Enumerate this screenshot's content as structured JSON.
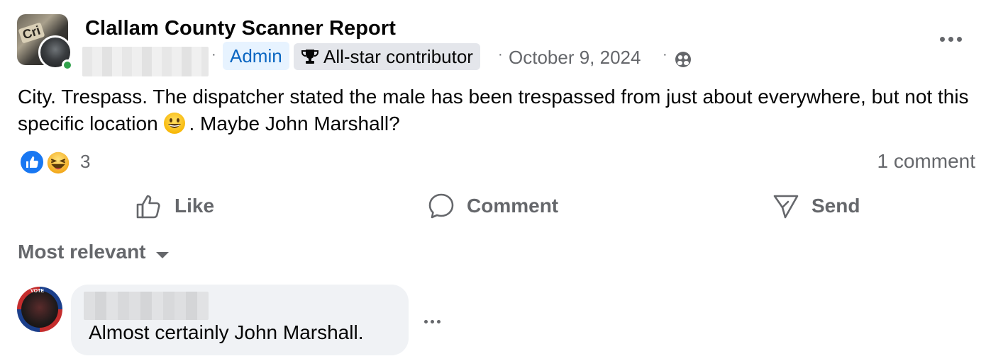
{
  "post": {
    "group_name": "Clallam County Scanner Report",
    "author_name_blurred": true,
    "separator": "·",
    "badges": {
      "admin": "Admin",
      "contributor": "All-star contributor"
    },
    "date": "October 9, 2024",
    "privacy_icon": "group-privacy-icon",
    "text_part1": "City. Trespass. The dispatcher stated the male has been trespassed from just about everywhere, but not this specific location ",
    "text_part2": ". Maybe John Marshall?",
    "inline_emoji": "grinning-face-emoji"
  },
  "reactions": {
    "types": [
      "like",
      "haha"
    ],
    "count": "3",
    "comment_count": "1 comment"
  },
  "actions": {
    "like": "Like",
    "comment": "Comment",
    "send": "Send"
  },
  "sort": {
    "label": "Most relevant"
  },
  "comments": [
    {
      "author_blurred": true,
      "text": "Almost certainly John Marshall."
    }
  ],
  "colors": {
    "secondary_text": "#65676b",
    "admin_blue": "#0a66c2",
    "admin_bg": "#e7f3ff",
    "badge_bg": "#e4e6eb",
    "like_blue": "#1877f2",
    "online_green": "#31a24c",
    "bubble_bg": "#f0f2f5"
  }
}
